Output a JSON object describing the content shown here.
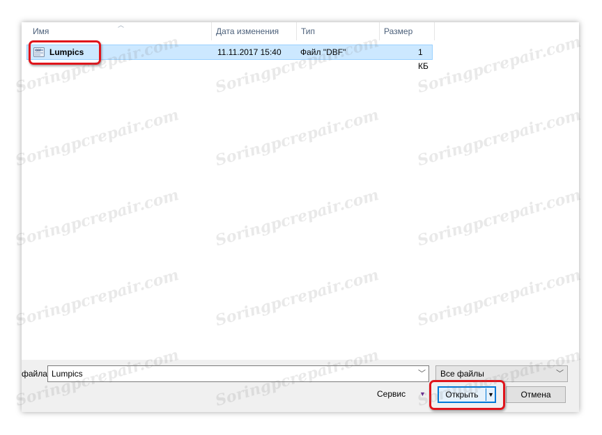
{
  "columns": {
    "name": "Имя",
    "date": "Дата изменения",
    "type": "Тип",
    "size": "Размер"
  },
  "files": [
    {
      "name": "Lumpics",
      "date": "11.11.2017 15:40",
      "type": "Файл \"DBF\"",
      "size": "1 КБ",
      "icon": "dbf-file-icon",
      "selected": true
    }
  ],
  "footer": {
    "filename_label": "файла:",
    "filename_value": "Lumpics",
    "filter_value": "Все файлы",
    "service_label": "Сервис",
    "open_label": "Открыть",
    "cancel_label": "Отмена"
  },
  "watermark": "Soringpcrepair.com",
  "colors": {
    "selection": "#cce8ff",
    "highlight_frame": "#e0141b",
    "accent": "#0078d7"
  }
}
